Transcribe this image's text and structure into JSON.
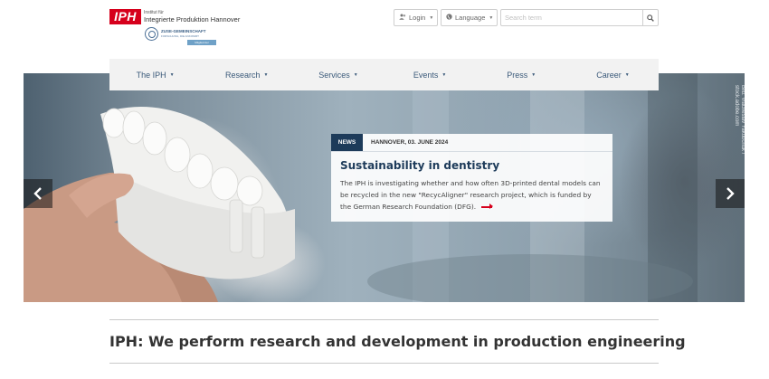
{
  "header": {
    "logo_text": "IPH",
    "institute_small": "Institut für",
    "institute_name": "Integrierte Produktion Hannover",
    "zuse_title": "ZUSE-GEMEINSCHAFT",
    "zuse_sub": "FORSCHUNG, DIE ANKOMMT",
    "zuse_badge": "Mitglied der",
    "login_label": "Login",
    "language_label": "Language",
    "search_placeholder": "Search term"
  },
  "nav": {
    "items": [
      {
        "label": "The IPH"
      },
      {
        "label": "Research"
      },
      {
        "label": "Services"
      },
      {
        "label": "Events"
      },
      {
        "label": "Press"
      },
      {
        "label": "Career"
      }
    ]
  },
  "hero": {
    "photo_credit": "Bild: Viacheslav Yakobchuk / stock.adobe.com",
    "news": {
      "tag": "NEWS",
      "date": "HANNOVER, 03. JUNE 2024",
      "title": "Sustainability in dentistry",
      "text": "The IPH is investigating whether and how often 3D-printed dental models can be recycled in the new \"RecycAligner\" research project, which is funded by the German Research Foundation (DFG)."
    }
  },
  "main": {
    "heading": "IPH: We perform research and development in production engineering"
  },
  "colors": {
    "brand_red": "#d6001c",
    "nav_text": "#3b5a7a",
    "news_tag_bg": "#1d3b5a"
  }
}
